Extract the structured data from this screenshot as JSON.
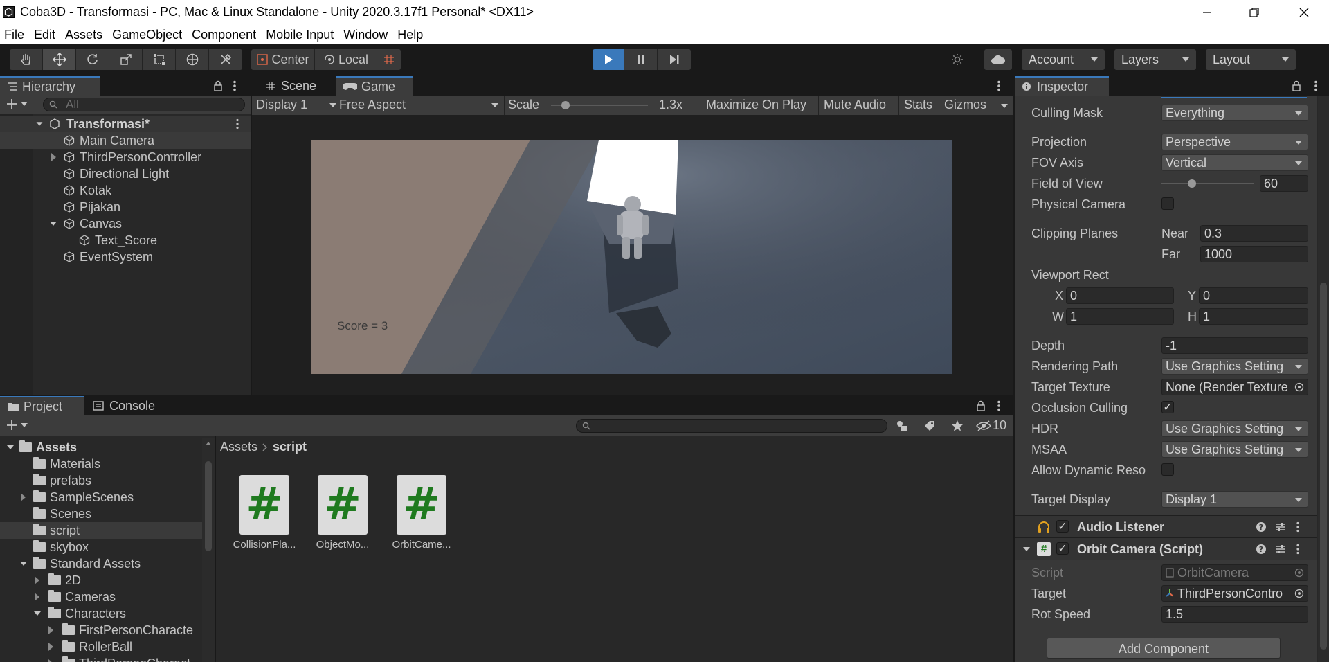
{
  "window": {
    "title": "Coba3D - Transformasi - PC, Mac & Linux Standalone - Unity 2020.3.17f1 Personal* <DX11>"
  },
  "menu": [
    "File",
    "Edit",
    "Assets",
    "GameObject",
    "Component",
    "Mobile Input",
    "Window",
    "Help"
  ],
  "toolbar": {
    "pivot": "Center",
    "space": "Local",
    "account": "Account",
    "layers": "Layers",
    "layout": "Layout"
  },
  "hierarchy": {
    "tab": "Hierarchy",
    "search_placeholder": "All",
    "scene": "Transformasi*",
    "items": [
      {
        "label": "Main Camera"
      },
      {
        "label": "ThirdPersonController"
      },
      {
        "label": "Directional Light"
      },
      {
        "label": "Kotak"
      },
      {
        "label": "Pijakan"
      },
      {
        "label": "Canvas"
      },
      {
        "label": "Text_Score"
      },
      {
        "label": "EventSystem"
      }
    ]
  },
  "game": {
    "tab_scene": "Scene",
    "tab_game": "Game",
    "display": "Display 1",
    "aspect": "Free Aspect",
    "scale_label": "Scale",
    "scale_value": "1.3x",
    "scale_level": 0.15,
    "maximize": "Maximize On Play",
    "mute": "Mute Audio",
    "stats": "Stats",
    "gizmos": "Gizmos",
    "score_text": "Score = 3"
  },
  "project": {
    "tab_project": "Project",
    "tab_console": "Console",
    "hidden_count": "10",
    "breadcrumb_root": "Assets",
    "breadcrumb_current": "script",
    "tree": [
      {
        "label": "Assets"
      },
      {
        "label": "Materials"
      },
      {
        "label": "prefabs"
      },
      {
        "label": "SampleScenes"
      },
      {
        "label": "Scenes"
      },
      {
        "label": "script"
      },
      {
        "label": "skybox"
      },
      {
        "label": "Standard Assets"
      },
      {
        "label": "2D"
      },
      {
        "label": "Cameras"
      },
      {
        "label": "Characters"
      },
      {
        "label": "FirstPersonCharacte"
      },
      {
        "label": "RollerBall"
      },
      {
        "label": "ThirdPersonCharact"
      }
    ],
    "assets": [
      {
        "label": "CollisionPla..."
      },
      {
        "label": "ObjectMo..."
      },
      {
        "label": "OrbitCame..."
      }
    ]
  },
  "inspector": {
    "tab": "Inspector",
    "rows": {
      "culling_mask": {
        "label": "Culling Mask",
        "value": "Everything"
      },
      "projection": {
        "label": "Projection",
        "value": "Perspective"
      },
      "fov_axis": {
        "label": "FOV Axis",
        "value": "Vertical"
      },
      "field_of_view": {
        "label": "Field of View",
        "value": "60",
        "level": 0.33
      },
      "physical_camera": {
        "label": "Physical Camera"
      },
      "clipping_planes": {
        "label": "Clipping Planes",
        "near_label": "Near",
        "near": "0.3",
        "far_label": "Far",
        "far": "1000"
      },
      "viewport_rect": {
        "label": "Viewport Rect",
        "x_label": "X",
        "x": "0",
        "y_label": "Y",
        "y": "0",
        "w_label": "W",
        "w": "1",
        "h_label": "H",
        "h": "1"
      },
      "depth": {
        "label": "Depth",
        "value": "-1"
      },
      "rendering_path": {
        "label": "Rendering Path",
        "value": "Use Graphics Setting"
      },
      "target_texture": {
        "label": "Target Texture",
        "value": "None (Render Texture"
      },
      "occlusion_culling": {
        "label": "Occlusion Culling",
        "checked": "✓"
      },
      "hdr": {
        "label": "HDR",
        "value": "Use Graphics Setting"
      },
      "msaa": {
        "label": "MSAA",
        "value": "Use Graphics Setting"
      },
      "allow_dynamic": {
        "label": "Allow Dynamic Reso"
      },
      "target_display": {
        "label": "Target Display",
        "value": "Display 1"
      }
    },
    "audio_listener": {
      "title": "Audio Listener",
      "checked": "✓"
    },
    "orbit_camera": {
      "title": "Orbit Camera (Script)",
      "checked": "✓",
      "script_label": "Script",
      "script_value": "OrbitCamera",
      "target_label": "Target",
      "target_value": "ThirdPersonContro",
      "rot_label": "Rot Speed",
      "rot_value": "1.5"
    },
    "add_component": "Add Component"
  }
}
